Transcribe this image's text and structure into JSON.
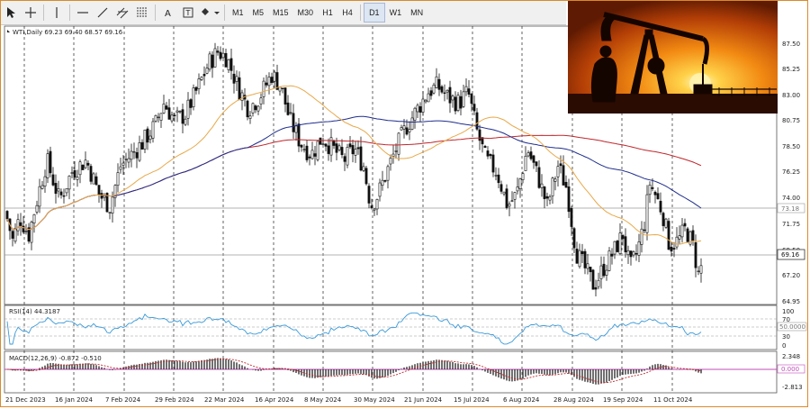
{
  "toolbar": {
    "timeframes": [
      "M1",
      "M5",
      "M15",
      "M30",
      "H1",
      "H4",
      "D1",
      "W1",
      "MN"
    ],
    "active_timeframe": "D1"
  },
  "chart": {
    "symbol_header": "WTI,Daily  69.23 69.40 68.57 69.16",
    "price_ticks": [
      "87.50",
      "85.25",
      "83.00",
      "80.75",
      "78.50",
      "76.25",
      "74.00",
      "71.75",
      "69.50",
      "67.20",
      "64.95"
    ],
    "price_labels": {
      "current": "69.16",
      "line": "73.18"
    },
    "date_ticks": [
      "21 Dec 2023",
      "16 Jan 2024",
      "7 Feb 2024",
      "29 Feb 2024",
      "22 Mar 2024",
      "16 Apr 2024",
      "8 May 2024",
      "30 May 2024",
      "21 Jun 2024",
      "15 Jul 2024",
      "6 Aug 2024",
      "28 Aug 2024",
      "19 Sep 2024",
      "11 Oct 2024"
    ]
  },
  "rsi": {
    "header": "RSI(14) 44.3187",
    "ticks": [
      "100",
      "70",
      "30",
      "0"
    ],
    "level_label": "50.0000"
  },
  "macd": {
    "header": "MACD(12,26,9) -0.872 -0.510",
    "ticks": [
      "2.348",
      "0.000",
      "-2.813"
    ]
  },
  "colors": {
    "ma_fast": "#e8a94a",
    "ma_mid": "#1f2e8c",
    "ma_slow": "#c0262b",
    "rsi_line": "#3a9ad9",
    "macd_signal": "#c0262b",
    "frame": "#d98a2b",
    "zero_line": "#c04bb8"
  },
  "icons": [
    "cursor-icon",
    "crosshair-icon",
    "vertical-line-icon",
    "horizontal-line-icon",
    "trendline-icon",
    "channel-icon",
    "fibonacci-icon",
    "text-icon",
    "label-icon",
    "shapes-icon"
  ]
}
